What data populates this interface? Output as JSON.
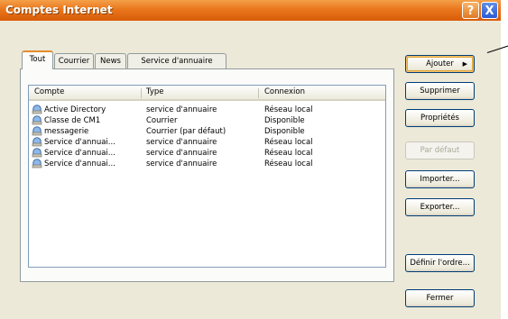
{
  "window": {
    "title": "Comptes Internet",
    "help_label": "?",
    "close_label": "X"
  },
  "tabs": [
    "Tout",
    "Courrier",
    "News",
    "Service d'annuaire"
  ],
  "columns": [
    "Compte",
    "Type",
    "Connexion"
  ],
  "rows": [
    {
      "account": "Active Directory",
      "type": "service d'annuaire",
      "connection": "Réseau local"
    },
    {
      "account": "Classe de CM1",
      "type": "Courrier",
      "connection": "Disponible"
    },
    {
      "account": "messagerie",
      "type": "Courrier (par défaut)",
      "connection": "Disponible"
    },
    {
      "account": "Service d'annuai...",
      "type": "service d'annuaire",
      "connection": "Réseau local"
    },
    {
      "account": "Service d'annuai...",
      "type": "service d'annuaire",
      "connection": "Réseau local"
    },
    {
      "account": "Service d'annuai...",
      "type": "service d'annuaire",
      "connection": "Réseau local"
    }
  ],
  "buttons": {
    "add": "Ajouter",
    "remove": "Supprimer",
    "properties": "Propriétés",
    "set_default": "Par défaut",
    "import": "Importer...",
    "export": "Exporter...",
    "set_order": "Définir l'ordre...",
    "close": "Fermer"
  },
  "colors": {
    "titlebar": "#e9761c",
    "close_button": "#2c5bd3",
    "focus_border": "#e68b2c"
  },
  "icons": {
    "add_arrow": "triangle-right-icon",
    "account_icon": "account-globe-icon"
  }
}
